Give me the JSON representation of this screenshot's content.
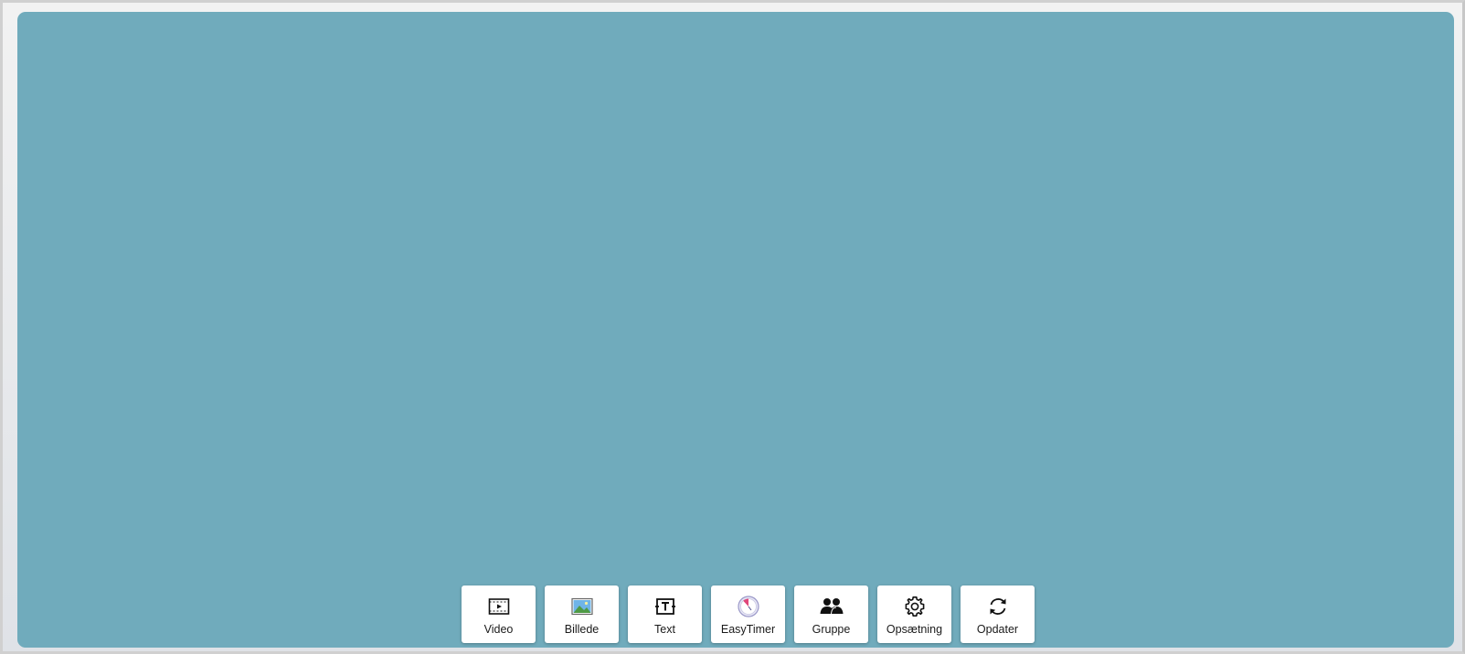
{
  "toolbar": {
    "buttons": [
      {
        "label": "Video",
        "icon": "video-icon"
      },
      {
        "label": "Billede",
        "icon": "image-icon"
      },
      {
        "label": "Text",
        "icon": "text-icon"
      },
      {
        "label": "EasyTimer",
        "icon": "timer-icon"
      },
      {
        "label": "Gruppe",
        "icon": "group-icon"
      },
      {
        "label": "Opsætning",
        "icon": "gear-icon"
      },
      {
        "label": "Opdater",
        "icon": "refresh-icon"
      }
    ]
  },
  "colors": {
    "canvas": "#70abbc",
    "button_bg": "#ffffff",
    "timer_accent": "#e0467a",
    "image_sky": "#6fb4e8",
    "image_land": "#4f9a45"
  }
}
